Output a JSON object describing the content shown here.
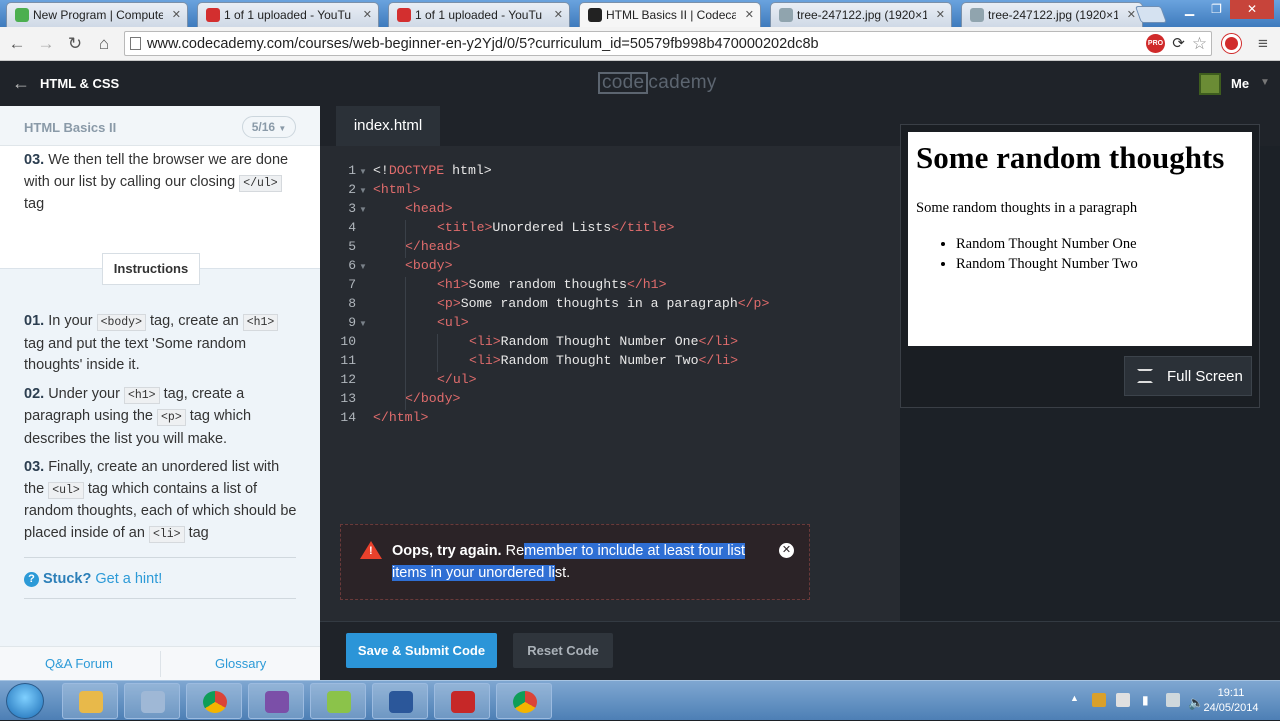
{
  "browser": {
    "tabs": [
      {
        "label": "New Program | Compute",
        "favicon_color": "#4caf50"
      },
      {
        "label": "1 of 1 uploaded - YouTu",
        "favicon_color": "#d32f2f"
      },
      {
        "label": "1 of 1 uploaded - YouTu",
        "favicon_color": "#d32f2f"
      },
      {
        "label": "HTML Basics II | Codecad",
        "favicon_color": "#222222",
        "active": true
      },
      {
        "label": "tree-247122.jpg (1920×10",
        "favicon_color": "#90a4ae"
      },
      {
        "label": "tree-247122.jpg (1920×10",
        "favicon_color": "#90a4ae"
      }
    ],
    "url": "www.codecademy.com/courses/web-beginner-en-y2Yjd/0/5?curriculum_id=50579fb998b470000202dc8b",
    "ext_badge": "PRO"
  },
  "header": {
    "course": "HTML & CSS",
    "logo_left": "code",
    "logo_right": "cademy",
    "user": "Me"
  },
  "lesson": {
    "title": "HTML Basics II",
    "progress": "5/16",
    "tip": {
      "num": "03.",
      "text_before": " We then tell the browser we are done with our list by calling our closing ",
      "code": "</ul>",
      "text_after": " tag"
    },
    "instructions_tab": "Instructions",
    "instructions": [
      {
        "num": "01.",
        "t1": " In your ",
        "c1": "<body>",
        "t2": " tag, create an ",
        "c2": "<h1>",
        "t3": " tag and put the text 'Some random thoughts' inside it."
      },
      {
        "num": "02.",
        "t1": " Under your ",
        "c1": "<h1>",
        "t2": " tag, create a paragraph using the ",
        "c2": "<p>",
        "t3": " tag which describes the list you will make."
      },
      {
        "num": "03.",
        "t1": " Finally, create an unordered list with the ",
        "c1": "<ul>",
        "t2": " tag which contains a list of random thoughts, each of which should be placed inside of an ",
        "c2": "<li>",
        "t3": " tag"
      }
    ],
    "stuck": "Stuck?",
    "hint": "Get a hint!",
    "footer": {
      "forum": "Q&A Forum",
      "glossary": "Glossary"
    }
  },
  "editor": {
    "filename": "index.html",
    "lines": [
      {
        "n": "1",
        "fold": true,
        "ind": 0,
        "parts": [
          [
            "p",
            "<!"
          ],
          [
            "t",
            "DOCTYPE"
          ],
          [
            "p",
            " html>"
          ]
        ]
      },
      {
        "n": "2",
        "fold": true,
        "ind": 0,
        "parts": [
          [
            "t",
            "<html>"
          ]
        ]
      },
      {
        "n": "3",
        "fold": true,
        "ind": 1,
        "parts": [
          [
            "t",
            "<head>"
          ]
        ]
      },
      {
        "n": "4",
        "fold": false,
        "ind": 2,
        "parts": [
          [
            "t",
            "<title>"
          ],
          [
            "p",
            "Unordered Lists"
          ],
          [
            "t",
            "</title>"
          ]
        ]
      },
      {
        "n": "5",
        "fold": false,
        "ind": 1,
        "parts": [
          [
            "t",
            "</head>"
          ]
        ]
      },
      {
        "n": "6",
        "fold": true,
        "ind": 1,
        "parts": [
          [
            "t",
            "<body>"
          ]
        ]
      },
      {
        "n": "7",
        "fold": false,
        "ind": 2,
        "parts": [
          [
            "t",
            "<h1>"
          ],
          [
            "p",
            "Some random thoughts"
          ],
          [
            "t",
            "</h1>"
          ]
        ]
      },
      {
        "n": "8",
        "fold": false,
        "ind": 2,
        "parts": [
          [
            "t",
            "<p>"
          ],
          [
            "p",
            "Some random thoughts in a paragraph"
          ],
          [
            "t",
            "</p>"
          ]
        ]
      },
      {
        "n": "9",
        "fold": true,
        "ind": 2,
        "parts": [
          [
            "t",
            "<ul>"
          ]
        ]
      },
      {
        "n": "10",
        "fold": false,
        "ind": 3,
        "parts": [
          [
            "t",
            "<li>"
          ],
          [
            "p",
            "Random Thought Number One"
          ],
          [
            "t",
            "</li>"
          ]
        ]
      },
      {
        "n": "11",
        "fold": false,
        "ind": 3,
        "parts": [
          [
            "t",
            "<li>"
          ],
          [
            "p",
            "Random Thought Number Two"
          ],
          [
            "t",
            "</li>"
          ]
        ]
      },
      {
        "n": "12",
        "fold": false,
        "ind": 2,
        "parts": [
          [
            "t",
            "</ul>"
          ]
        ]
      },
      {
        "n": "13",
        "fold": false,
        "ind": 1,
        "parts": [
          [
            "t",
            "</body>"
          ]
        ]
      },
      {
        "n": "14",
        "fold": false,
        "ind": 0,
        "parts": [
          [
            "t",
            "</html>"
          ]
        ]
      }
    ]
  },
  "preview": {
    "h1": "Some random thoughts",
    "p": "Some random thoughts in a paragraph",
    "items": [
      "Random Thought Number One",
      "Random Thought Number Two"
    ],
    "fullscreen": "Full Screen"
  },
  "error": {
    "bold": "Oops, try again.",
    "pre": " Re",
    "selected": "member to include at least four list items in your unordered li",
    "post": "st."
  },
  "actions": {
    "submit": "Save & Submit Code",
    "reset": "Reset Code"
  },
  "taskbar": {
    "apps": [
      "explorer-icon",
      "network-icon",
      "chrome-icon",
      "visual-studio-icon",
      "tor-icon",
      "word-icon",
      "media-icon",
      "chrome-icon"
    ],
    "time": "19:11",
    "date": "24/05/2014"
  },
  "colors": {
    "accent": "#2b95d8",
    "tag": "#e06c6c",
    "error": "#e8412c"
  }
}
